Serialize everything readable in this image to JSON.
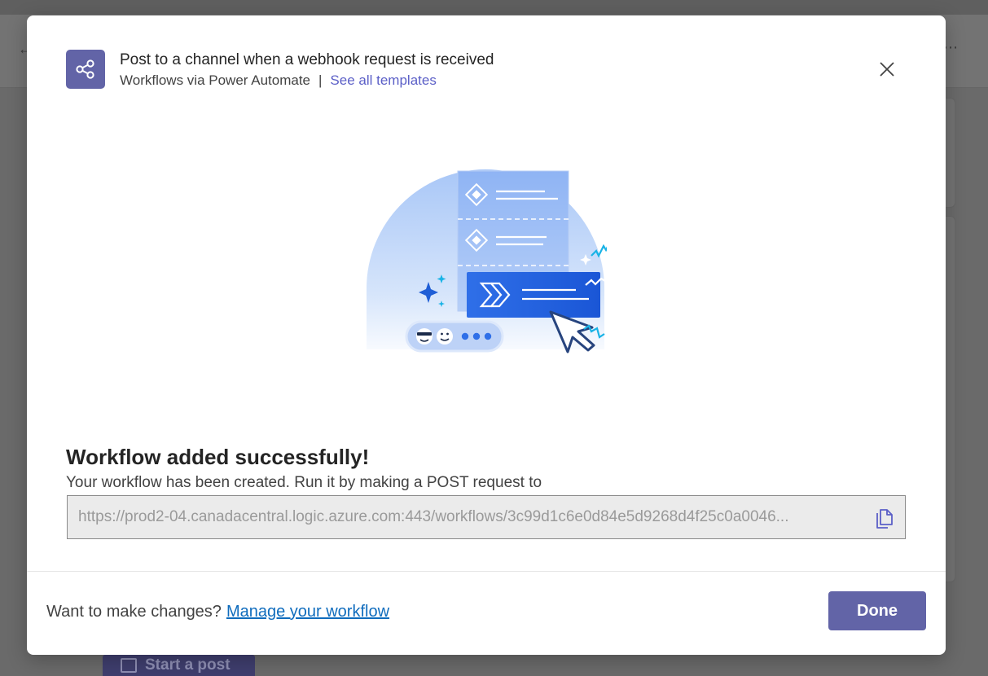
{
  "background": {
    "start_post_label": "Start a post"
  },
  "dialog": {
    "title": "Post to a channel when a webhook request is received",
    "subtitle": "Workflows via Power Automate",
    "separator": "|",
    "templates_link": "See all templates",
    "header_icon": "share-nodes-icon",
    "close_icon": "close-icon"
  },
  "success": {
    "heading": "Workflow added successfully!",
    "description": "Your workflow has been created. Run it by making a POST request to",
    "url": "https://prod2-04.canadacentral.logic.azure.com:443/workflows/3c99d1c6e0d84e5d9268d4f25c0a0046...",
    "copy_icon": "copy-icon"
  },
  "footer": {
    "prompt": "Want to make changes?",
    "manage_link": "Manage your workflow",
    "done_label": "Done"
  },
  "colors": {
    "brand": "#6264a7",
    "link": "#0f6cbd",
    "accent_blue": "#2266e8"
  }
}
